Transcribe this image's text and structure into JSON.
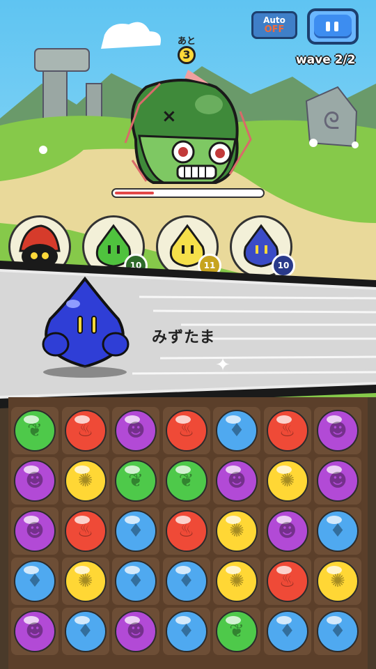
{
  "hud": {
    "auto_label": "Auto",
    "auto_state": "OFF",
    "pause_icon": "pause-icon",
    "wave_text": "wave 2/2",
    "turns_label": "あと",
    "turns_value": "3"
  },
  "enemy": {
    "name": "green zombie head",
    "hp_fraction": 0.26
  },
  "party": [
    {
      "name": "red-hat-mage",
      "color": "#d63b2b",
      "level": ""
    },
    {
      "name": "green-slime",
      "color": "#4fc23e",
      "level": "10"
    },
    {
      "name": "yellow-slime",
      "color": "#f5e04a",
      "level": "11"
    },
    {
      "name": "blue-slime",
      "color": "#3b4cc7",
      "level": "10"
    }
  ],
  "banner": {
    "monster_name": "みずたま",
    "monster_color": "#2f3ed6"
  },
  "board": {
    "rows": [
      [
        "green",
        "red",
        "purple",
        "red",
        "blue",
        "red",
        "purple"
      ],
      [
        "purple",
        "yellow",
        "green",
        "green",
        "purple",
        "yellow",
        "purple"
      ],
      [
        "purple",
        "red",
        "blue",
        "red",
        "yellow",
        "purple",
        "blue"
      ],
      [
        "blue",
        "yellow",
        "blue",
        "blue",
        "yellow",
        "red",
        "yellow"
      ],
      [
        "purple",
        "blue",
        "purple",
        "blue",
        "green",
        "blue",
        "blue"
      ]
    ],
    "orb_colors": {
      "green": {
        "fill": "#4ec94a",
        "sym": "❦",
        "icon": "leaf-icon"
      },
      "red": {
        "fill": "#ef4a37",
        "sym": "♨",
        "icon": "fire-icon"
      },
      "purple": {
        "fill": "#b24ad6",
        "sym": "☻",
        "icon": "demon-icon"
      },
      "blue": {
        "fill": "#4fa9f0",
        "sym": "♦",
        "icon": "water-drop-icon"
      },
      "yellow": {
        "fill": "#ffd735",
        "sym": "✺",
        "icon": "light-icon"
      }
    }
  }
}
